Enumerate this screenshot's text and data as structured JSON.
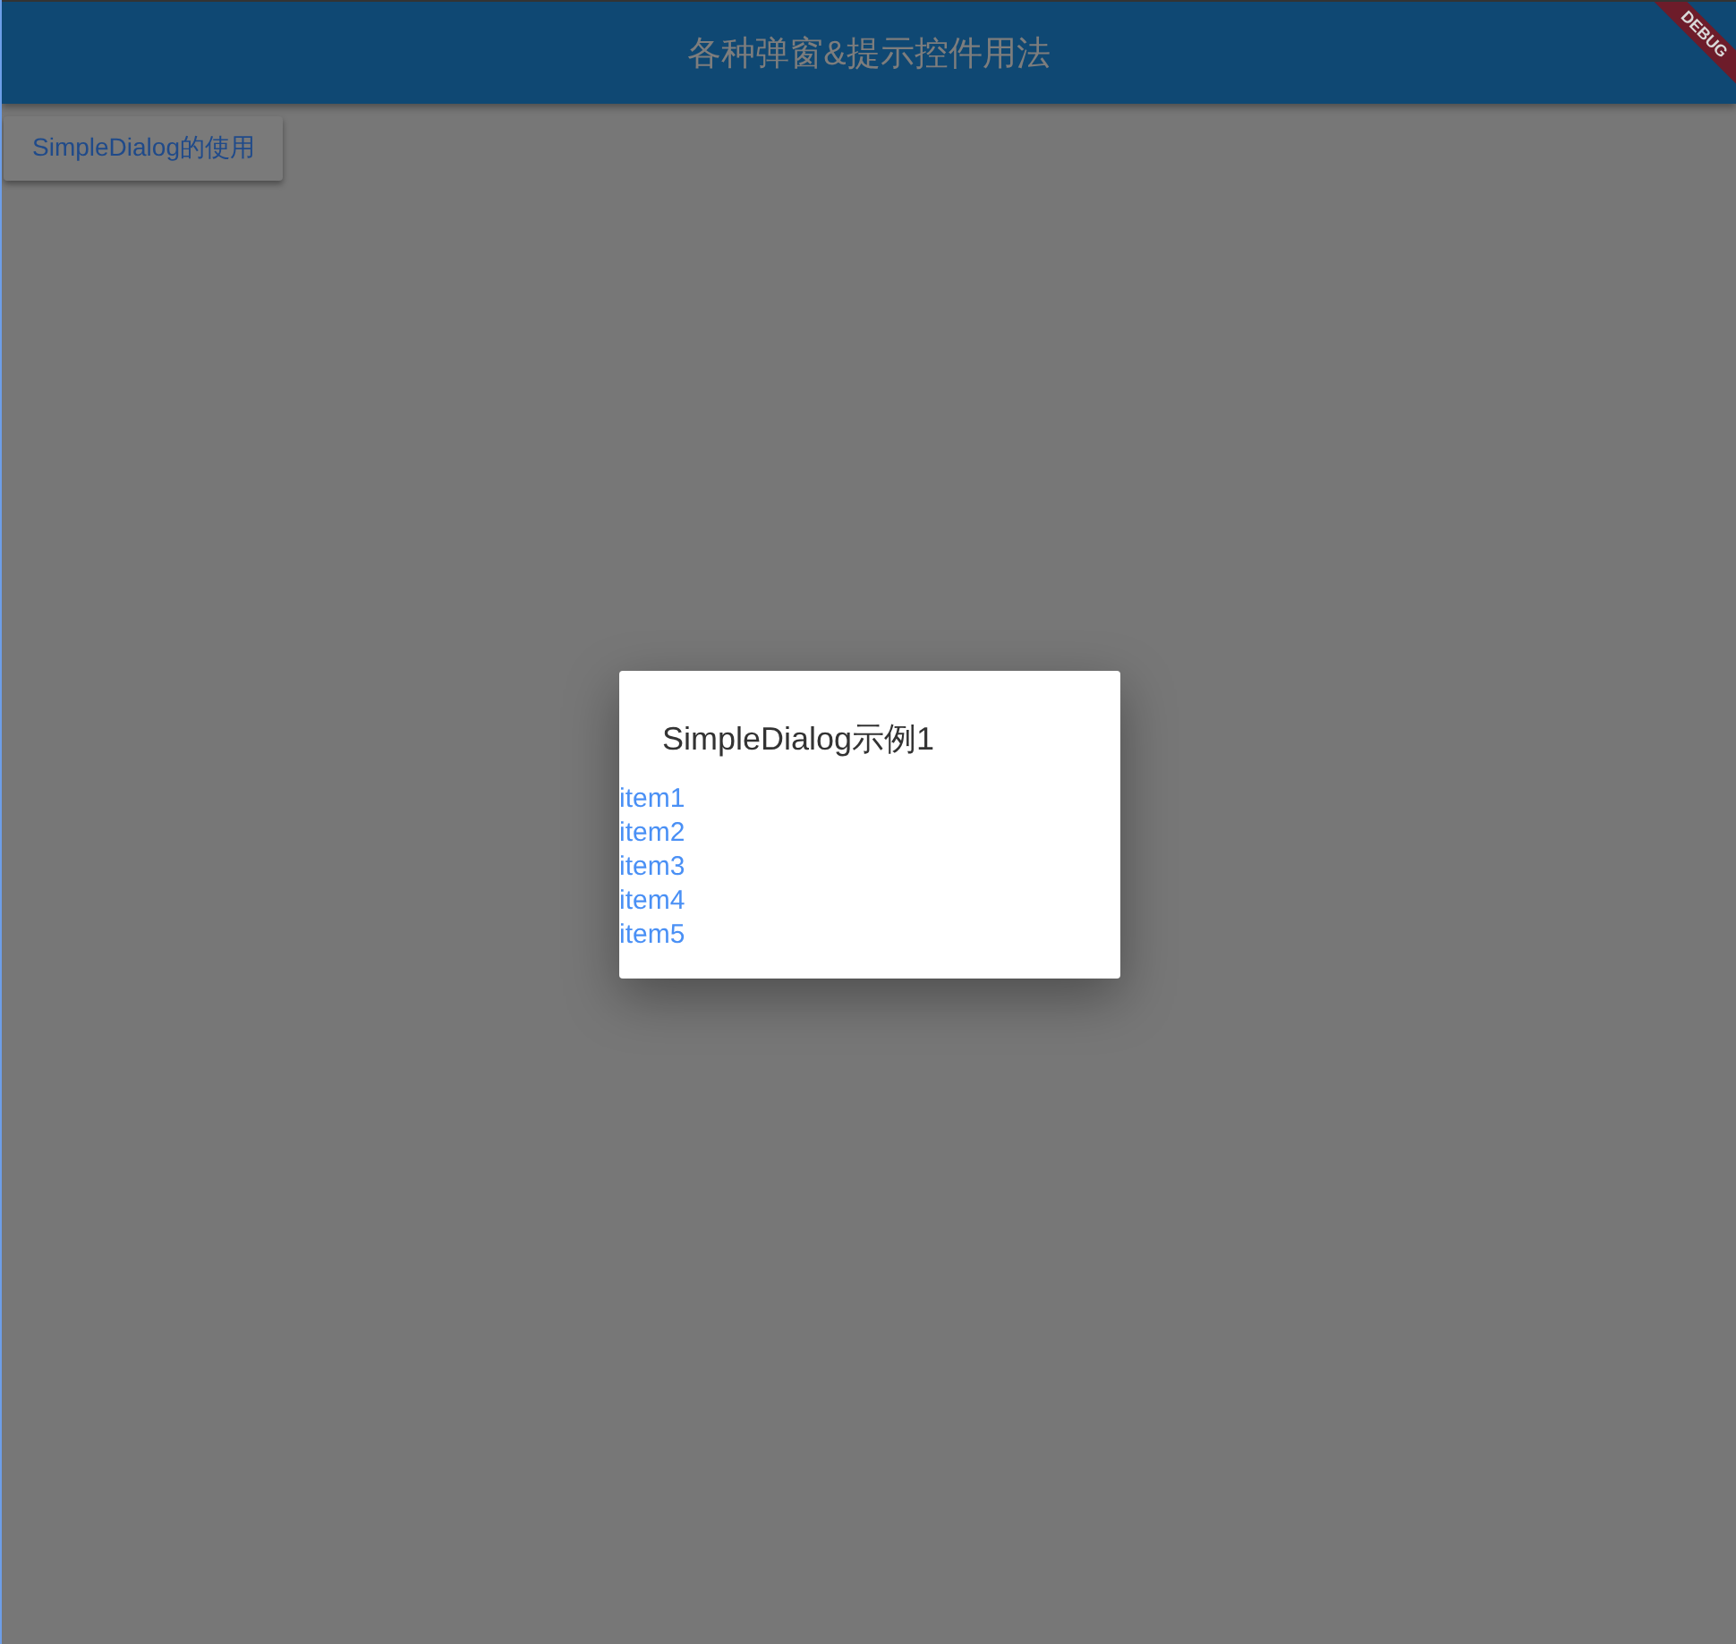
{
  "app_bar": {
    "title": "各种弹窗&提示控件用法"
  },
  "debug_banner": "DEBUG",
  "open_button": "SimpleDialog的使用",
  "dialog": {
    "title": "SimpleDialog示例1",
    "options": [
      "item1",
      "item2",
      "item3",
      "item4",
      "item5"
    ]
  }
}
